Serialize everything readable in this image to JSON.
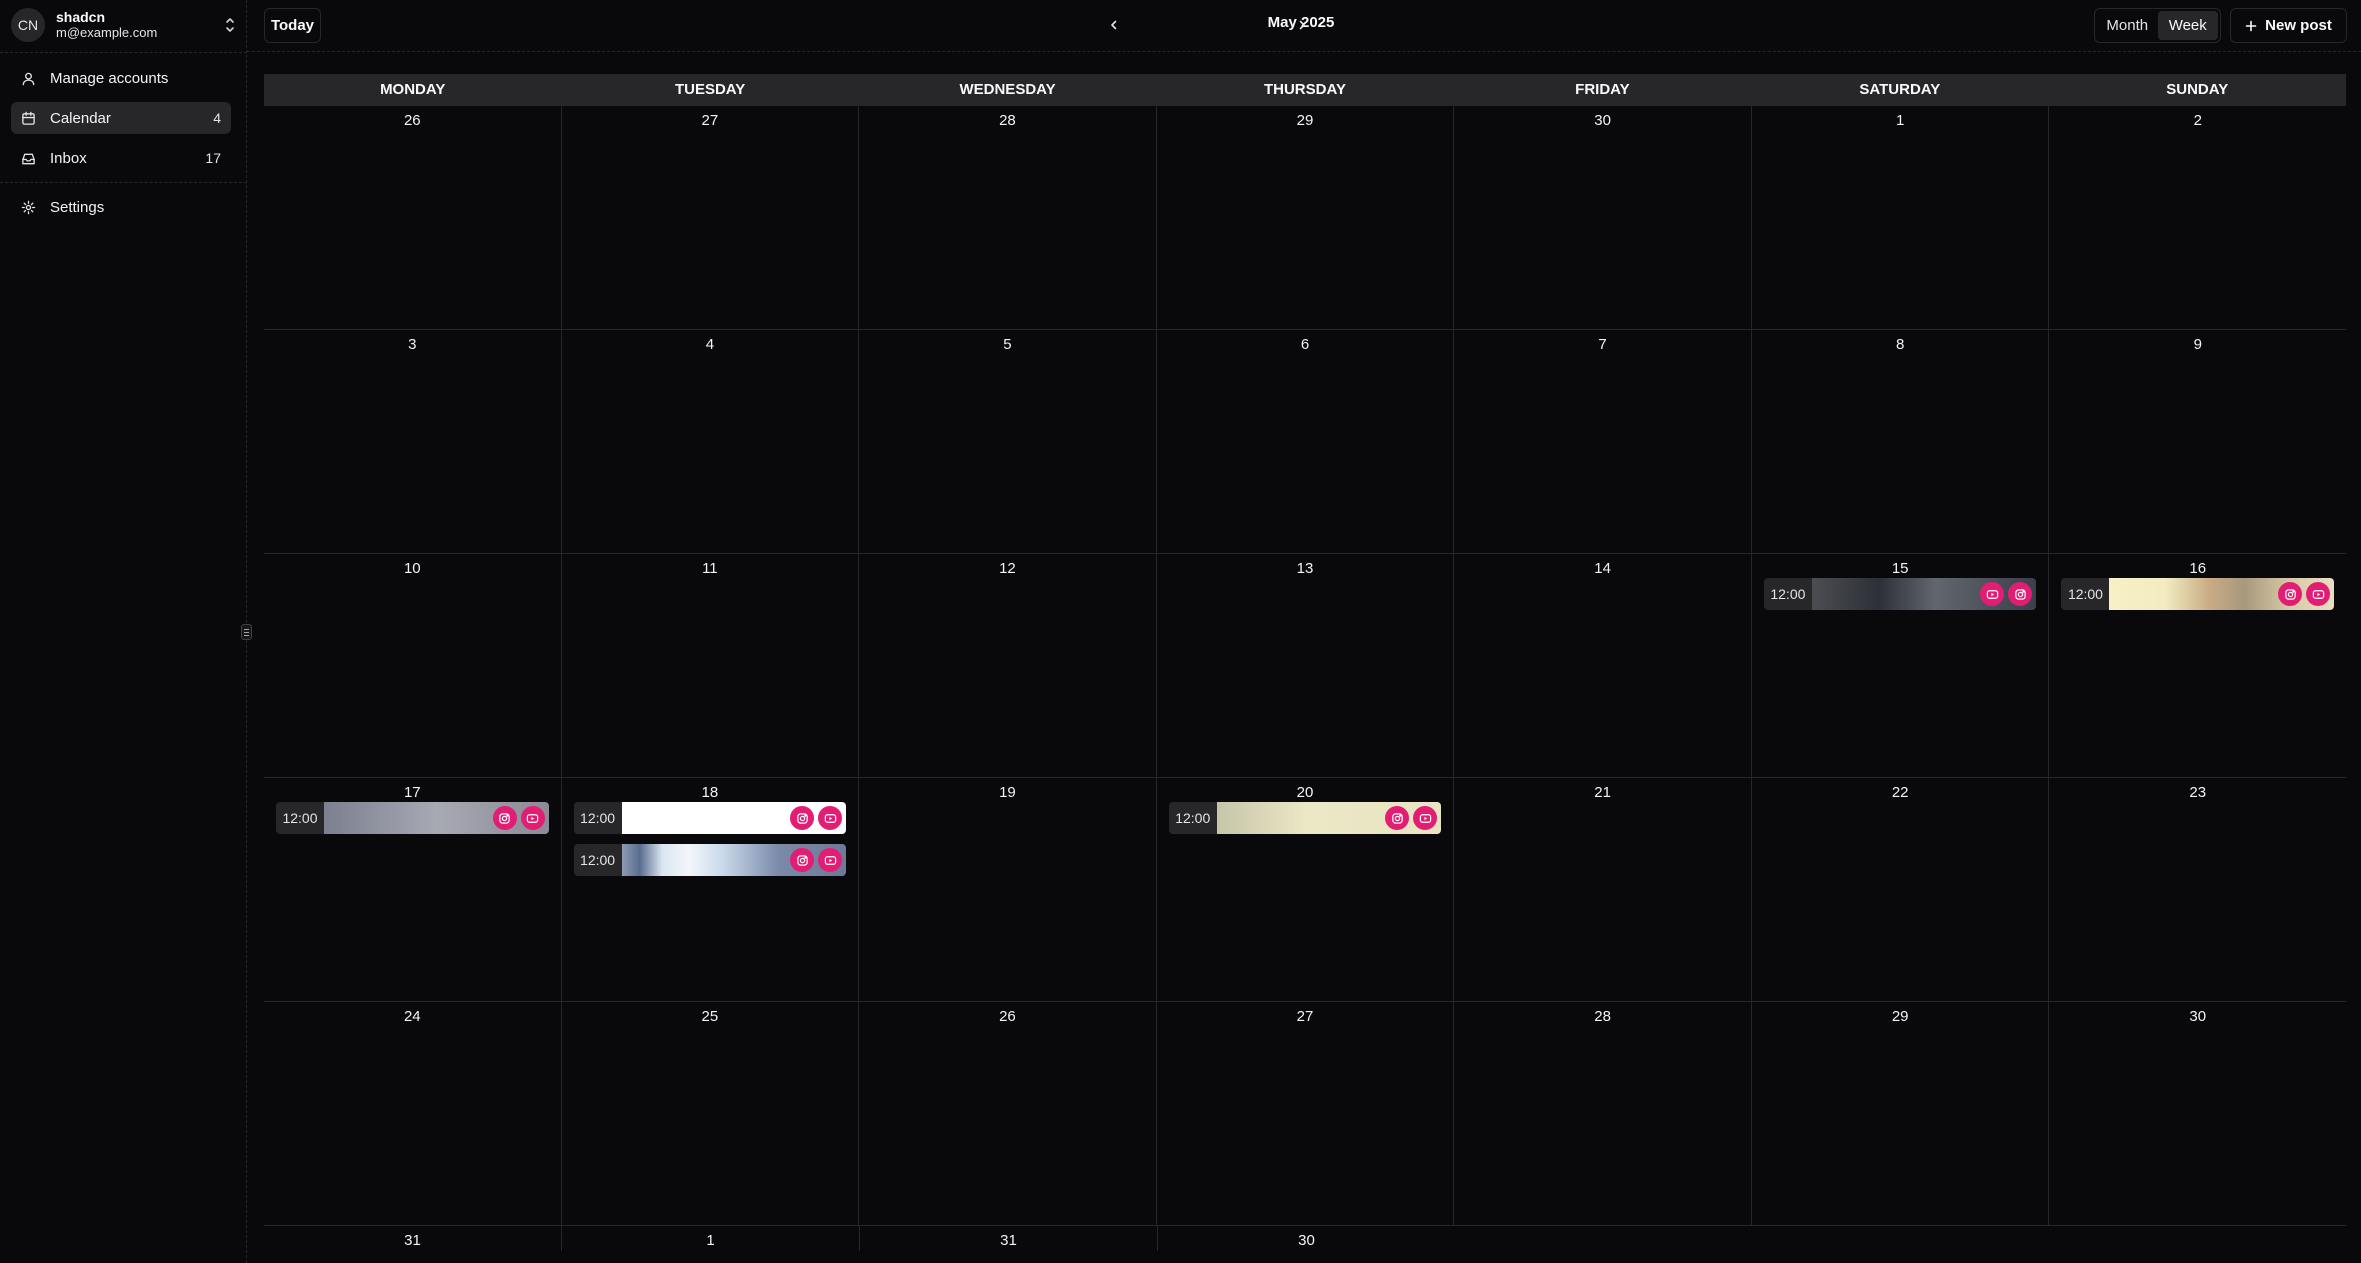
{
  "account": {
    "initials": "CN",
    "name": "shadcn",
    "email": "m@example.com"
  },
  "sidebar": {
    "items": [
      {
        "label": "Manage accounts",
        "icon": "user-icon",
        "count": ""
      },
      {
        "label": "Calendar",
        "icon": "calendar-icon",
        "count": "4"
      },
      {
        "label": "Inbox",
        "icon": "inbox-icon",
        "count": "17"
      },
      {
        "label": "Settings",
        "icon": "gear-icon",
        "count": ""
      }
    ]
  },
  "toolbar": {
    "today_label": "Today",
    "month_label": "May 2025",
    "view_month": "Month",
    "view_week": "Week",
    "new_post_label": "New post"
  },
  "calendar": {
    "weekdays": [
      "MONDAY",
      "TUESDAY",
      "WEDNESDAY",
      "THURSDAY",
      "FRIDAY",
      "SATURDAY",
      "SUNDAY"
    ],
    "weeks": [
      [
        "26",
        "27",
        "28",
        "29",
        "30",
        "1",
        "2"
      ],
      [
        "3",
        "4",
        "5",
        "6",
        "7",
        "8",
        "9"
      ],
      [
        "10",
        "11",
        "12",
        "13",
        "14",
        "15",
        "16"
      ],
      [
        "17",
        "18",
        "19",
        "20",
        "21",
        "22",
        "23"
      ],
      [
        "24",
        "25",
        "26",
        "27",
        "28",
        "29",
        "30"
      ],
      [
        "31",
        "1",
        "31",
        "30",
        "",
        "",
        ""
      ]
    ],
    "posts": {
      "sat15": {
        "time": "12:00",
        "icons": [
          "youtube-icon",
          "instagram-icon"
        ]
      },
      "sun16": {
        "time": "12:00",
        "icons": [
          "instagram-icon",
          "youtube-icon"
        ]
      },
      "mon17": {
        "time": "12:00",
        "icons": [
          "instagram-icon",
          "youtube-icon"
        ]
      },
      "tue18a": {
        "time": "12:00",
        "icons": [
          "instagram-icon",
          "youtube-icon"
        ]
      },
      "tue18b": {
        "time": "12:00",
        "icons": [
          "instagram-icon",
          "youtube-icon"
        ]
      },
      "thu20": {
        "time": "12:00",
        "icons": [
          "instagram-icon",
          "youtube-icon"
        ]
      }
    }
  },
  "colors": {
    "background": "#09090b",
    "border": "#27272a",
    "accent_social": "#e11d74"
  }
}
